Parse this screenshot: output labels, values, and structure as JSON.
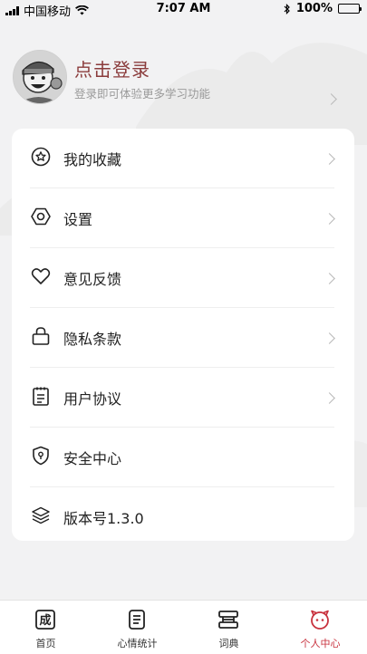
{
  "status_bar": {
    "carrier": "中国移动",
    "time": "7:07 AM",
    "battery": "100%"
  },
  "profile": {
    "title": "点击登录",
    "subtitle": "登录即可体验更多学习功能"
  },
  "menu": {
    "items": [
      {
        "label": "我的收藏",
        "icon": "star-circle-icon"
      },
      {
        "label": "设置",
        "icon": "gear-hexagon-icon"
      },
      {
        "label": "意见反馈",
        "icon": "heart-icon"
      },
      {
        "label": "隐私条款",
        "icon": "lock-icon"
      },
      {
        "label": "用户协议",
        "icon": "clipboard-icon"
      },
      {
        "label": "安全中心",
        "icon": "shield-icon"
      },
      {
        "label": "版本号1.3.0",
        "icon": "layers-icon"
      }
    ]
  },
  "tabbar": {
    "tabs": [
      {
        "label": "首页",
        "icon": "cheng-character-icon"
      },
      {
        "label": "心情统计",
        "icon": "mood-list-icon"
      },
      {
        "label": "词典",
        "icon": "dictionary-icon"
      },
      {
        "label": "个人中心",
        "icon": "smiley-icon",
        "active": true
      }
    ],
    "active_color": "#c8323e"
  },
  "colors": {
    "accent": "#8a3b3b",
    "active_tab": "#c8323e",
    "background": "#f2f2f3",
    "card": "#ffffff"
  }
}
